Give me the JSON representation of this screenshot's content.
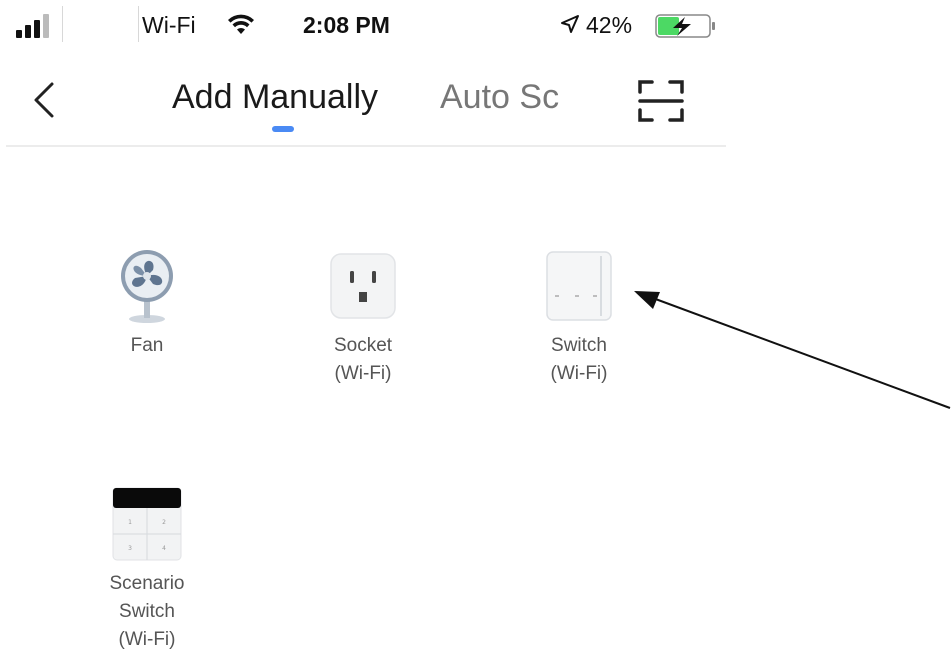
{
  "status_bar": {
    "carrier": "Wi-Fi",
    "time": "2:08 PM",
    "battery_percent": "42%",
    "battery_level": 0.42,
    "icons": [
      "signal-icon",
      "wifi-icon",
      "location-icon",
      "battery-charging-icon"
    ]
  },
  "nav": {
    "tabs": [
      {
        "label": "Add Manually",
        "active": true
      },
      {
        "label": "Auto Sc",
        "active": false
      }
    ],
    "icons": [
      "back-chevron-icon",
      "scan-icon"
    ],
    "accent_color": "#4a8af4"
  },
  "devices": [
    {
      "label": "Fan",
      "icon": "fan-icon"
    },
    {
      "label": "Socket\n(Wi-Fi)",
      "icon": "socket-icon"
    },
    {
      "label": "Switch\n(Wi-Fi)",
      "icon": "switch-icon"
    },
    {
      "label": "Scenario\nSwitch\n(Wi-Fi)",
      "icon": "scenario-switch-icon"
    }
  ]
}
